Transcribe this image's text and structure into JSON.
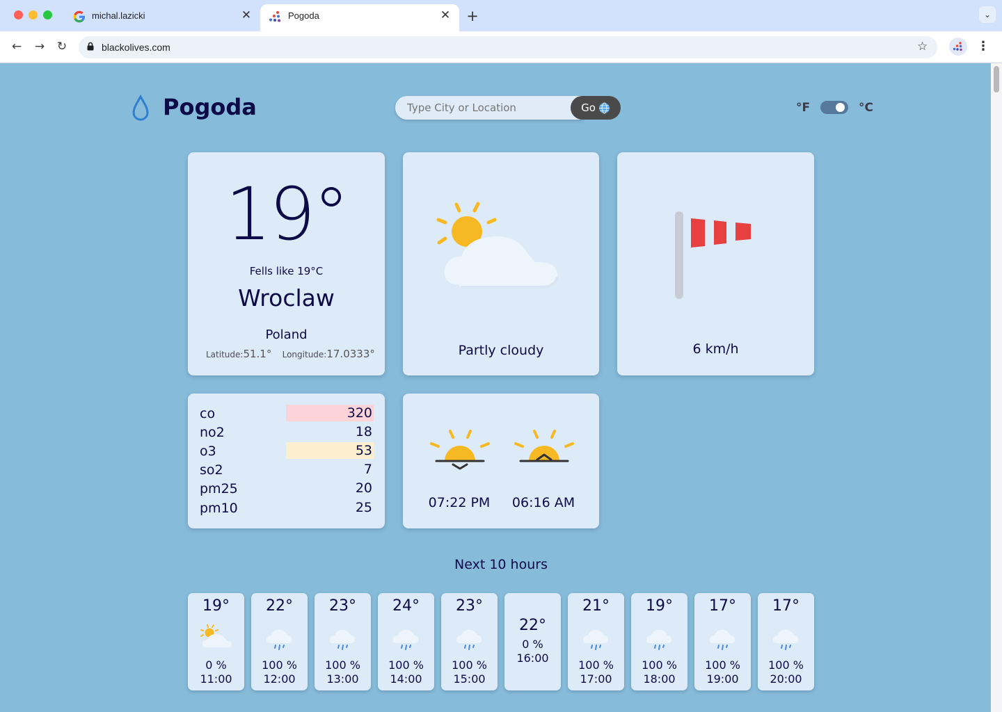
{
  "browser": {
    "tabs": [
      {
        "title": "michal.lazicki"
      },
      {
        "title": "Pogoda"
      }
    ],
    "url": "blackolives.com"
  },
  "header": {
    "brand": "Pogoda",
    "search_placeholder": "Type City or Location",
    "go_label": "Go",
    "unit_f": "°F",
    "unit_c": "°C",
    "unit_celsius_selected": true
  },
  "current": {
    "temp": "19°",
    "feels_like": "Fells like 19°C",
    "city": "Wroclaw",
    "country": "Poland",
    "latitude_label": "Latitude:",
    "latitude": "51.1°",
    "longitude_label": "Longitude:",
    "longitude": "17.0333°",
    "condition": "Partly cloudy",
    "wind": "6 km/h"
  },
  "air_quality": [
    {
      "name": "co",
      "value": "320",
      "highlight": "#fad4d8"
    },
    {
      "name": "no2",
      "value": "18",
      "highlight": ""
    },
    {
      "name": "o3",
      "value": "53",
      "highlight": "#fcefd0"
    },
    {
      "name": "so2",
      "value": "7",
      "highlight": ""
    },
    {
      "name": "pm25",
      "value": "20",
      "highlight": ""
    },
    {
      "name": "pm10",
      "value": "25",
      "highlight": ""
    }
  ],
  "sun": {
    "sunset": "07:22 PM",
    "sunrise": "06:16 AM"
  },
  "forecast": {
    "title": "Next 10 hours",
    "hours": [
      {
        "temp": "19°",
        "precip": "0 %",
        "time": "11:00",
        "icon": "partly-cloudy-icon"
      },
      {
        "temp": "22°",
        "precip": "100 %",
        "time": "12:00",
        "icon": "rain-icon"
      },
      {
        "temp": "23°",
        "precip": "100 %",
        "time": "13:00",
        "icon": "rain-icon"
      },
      {
        "temp": "24°",
        "precip": "100 %",
        "time": "14:00",
        "icon": "rain-icon"
      },
      {
        "temp": "23°",
        "precip": "100 %",
        "time": "15:00",
        "icon": "rain-icon"
      },
      {
        "temp": "22°",
        "precip": "0 %",
        "time": "16:00",
        "icon": ""
      },
      {
        "temp": "21°",
        "precip": "100 %",
        "time": "17:00",
        "icon": "rain-icon"
      },
      {
        "temp": "19°",
        "precip": "100 %",
        "time": "18:00",
        "icon": "rain-icon"
      },
      {
        "temp": "17°",
        "precip": "100 %",
        "time": "19:00",
        "icon": "rain-icon"
      },
      {
        "temp": "17°",
        "precip": "100 %",
        "time": "20:00",
        "icon": "rain-icon"
      }
    ]
  }
}
